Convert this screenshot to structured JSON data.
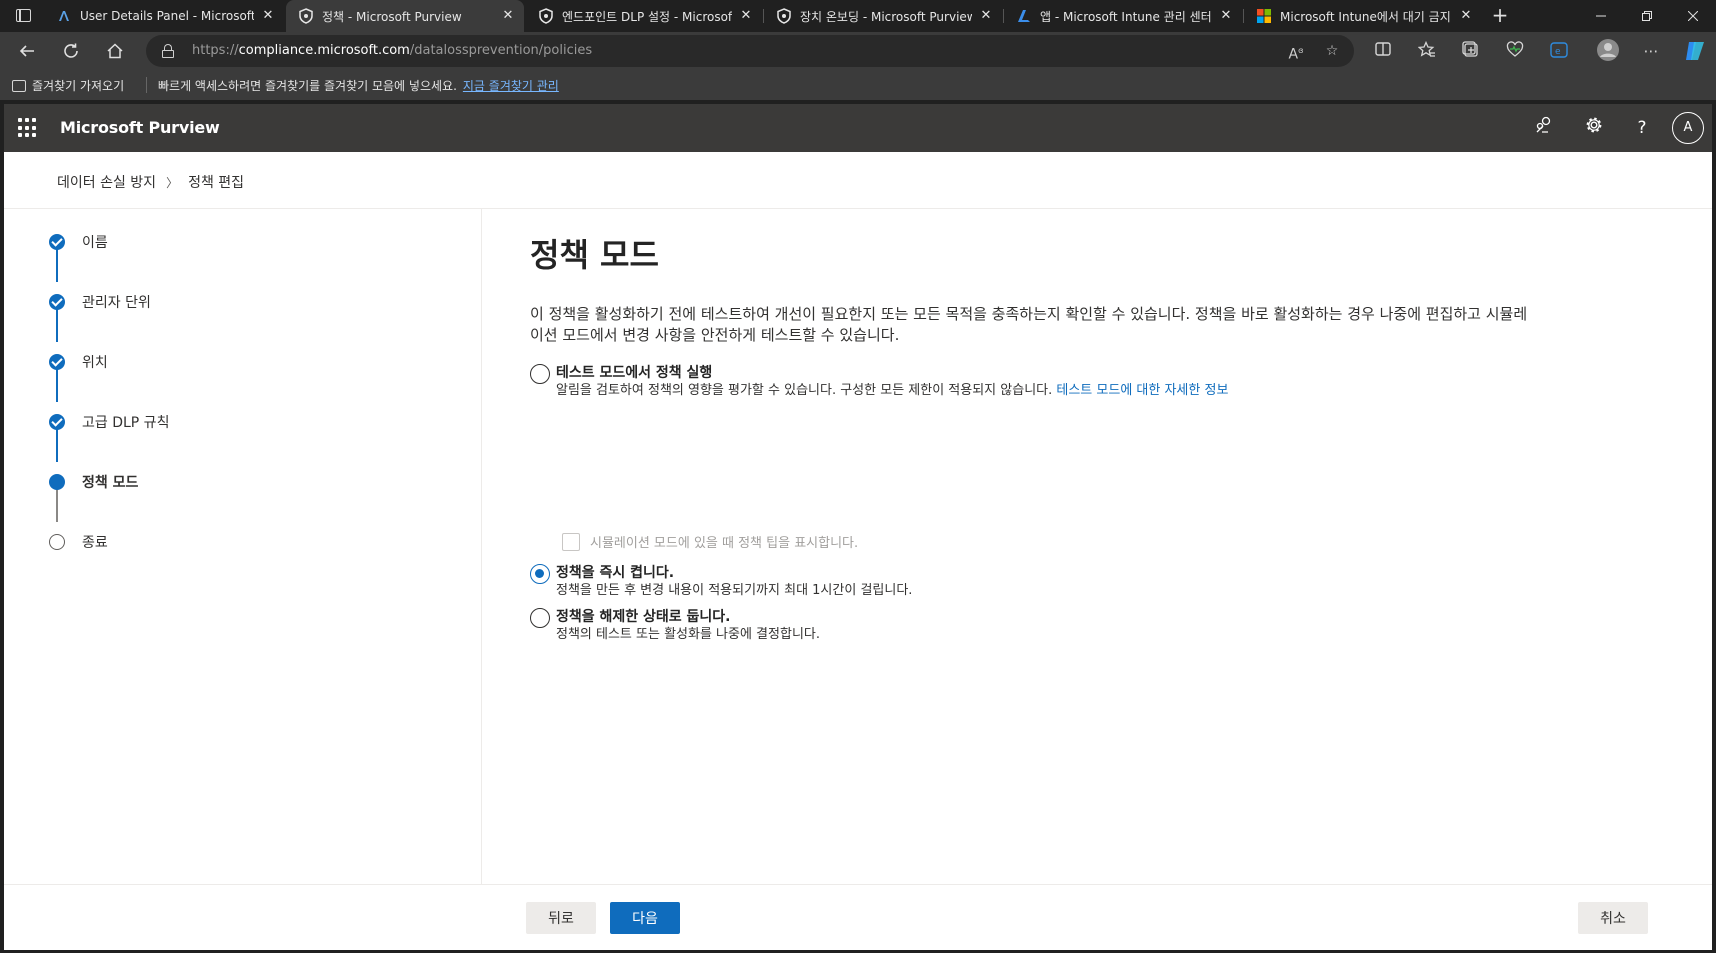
{
  "browser": {
    "tabs": [
      {
        "title": "User Details Panel - Microsoft 365",
        "close": "✕"
      },
      {
        "title": "정책 - Microsoft Purview",
        "close": "✕"
      },
      {
        "title": "엔드포인트 DLP 설정 - Microsoft",
        "close": "✕"
      },
      {
        "title": "장치 온보딩 - Microsoft Purview",
        "close": "✕"
      },
      {
        "title": "앱 - Microsoft Intune 관리 센터",
        "close": "✕"
      },
      {
        "title": "Microsoft Intune에서 대기 금지 ...",
        "close": "✕"
      }
    ],
    "newtab": "+",
    "url_prefix": "https://",
    "url_host": "compliance.microsoft.com",
    "url_path": "/datalossprevention/policies",
    "favorites_import": "즐겨찾기 가져오기",
    "favorites_message": "빠르게 액세스하려면 즐겨찾기를 즐겨찾기 모음에 넣으세요.",
    "favorites_link": "지금 즐겨찾기 관리"
  },
  "app": {
    "brand": "Microsoft Purview",
    "avatar_initial": "A"
  },
  "breadcrumb": {
    "root": "데이터 손실 방지",
    "current": "정책 편집"
  },
  "steps": [
    {
      "label": "이름",
      "state": "done"
    },
    {
      "label": "관리자 단위",
      "state": "done"
    },
    {
      "label": "위치",
      "state": "done"
    },
    {
      "label": "고급 DLP 규칙",
      "state": "done"
    },
    {
      "label": "정책 모드",
      "state": "current"
    },
    {
      "label": "종료",
      "state": "todo"
    }
  ],
  "main": {
    "title": "정책 모드",
    "description": "이 정책을 활성화하기 전에 테스트하여 개선이 필요한지 또는 모든 목적을 충족하는지 확인할 수 있습니다. 정책을 바로 활성화하는 경우 나중에 편집하고 시뮬레이션 모드에서 변경 사항을 안전하게 테스트할 수 있습니다.",
    "options": [
      {
        "title": "테스트 모드에서 정책 실행",
        "sub": "알림을 검토하여 정책의 영향을 평가할 수 있습니다. 구성한 모든 제한이 적용되지 않습니다.",
        "link": "테스트 모드에 대한 자세한 정보",
        "selected": false
      },
      {
        "title": "정책을 즉시 켭니다.",
        "sub": "정책을 만든 후 변경 내용이 적용되기까지 최대 1시간이 걸립니다.",
        "selected": true
      },
      {
        "title": "정책을 해제한 상태로 둡니다.",
        "sub": "정책의 테스트 또는 활성화를 나중에 결정합니다.",
        "selected": false
      }
    ],
    "sim_checkbox": "시뮬레이션 모드에 있을 때 정책 팁을 표시합니다."
  },
  "footer": {
    "back": "뒤로",
    "next": "다음",
    "cancel": "취소"
  },
  "colors": {
    "accent": "#0f6cbd",
    "suitebar": "#3b3a39"
  }
}
